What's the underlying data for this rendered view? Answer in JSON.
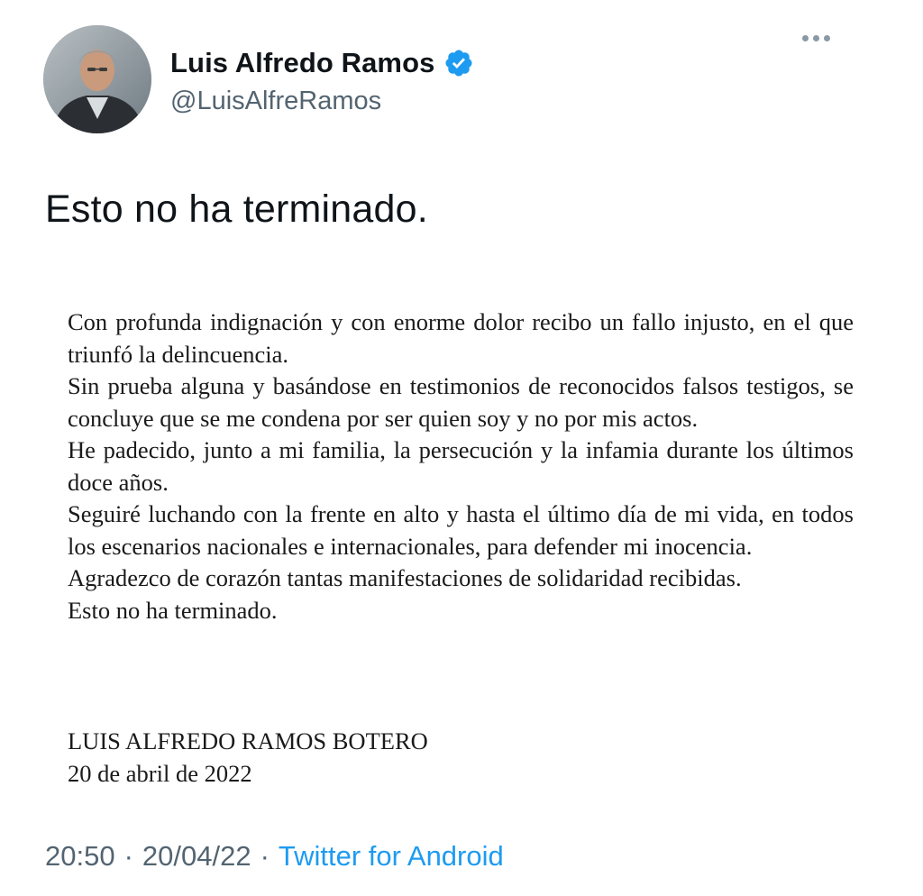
{
  "author": {
    "display_name": "Luis Alfredo Ramos",
    "handle": "@LuisAlfreRamos",
    "verified_icon": "verified-badge-icon",
    "avatar_icon": "profile-photo"
  },
  "more_icon": "more-options-icon",
  "tweet_text": "Esto no ha terminado.",
  "statement": {
    "paragraphs": [
      "Con profunda indignación y con enorme dolor recibo un fallo injusto, en el que triunfó la delincuencia.",
      "Sin prueba alguna y basándose en testimonios de reconocidos falsos testigos, se concluye que se me condena por ser quien soy y no por mis actos.",
      "He padecido, junto a mi familia, la persecución y la infamia durante los últimos doce años.",
      "Seguiré luchando con la frente en alto y hasta el último día de mi vida, en todos los escenarios nacionales e internacionales, para defender mi inocencia.",
      "Agradezco de corazón tantas manifestaciones de solidaridad recibidas.",
      "Esto no ha terminado."
    ],
    "signature_name": "LUIS ALFREDO RAMOS BOTERO",
    "signature_date": "20 de abril de 2022"
  },
  "meta": {
    "time": "20:50",
    "separator": "·",
    "date": "20/04/22",
    "source": "Twitter for Android"
  },
  "colors": {
    "text_primary": "#0f1419",
    "text_secondary": "#536471",
    "link": "#1d9bf0",
    "verified": "#1d9bf0"
  }
}
